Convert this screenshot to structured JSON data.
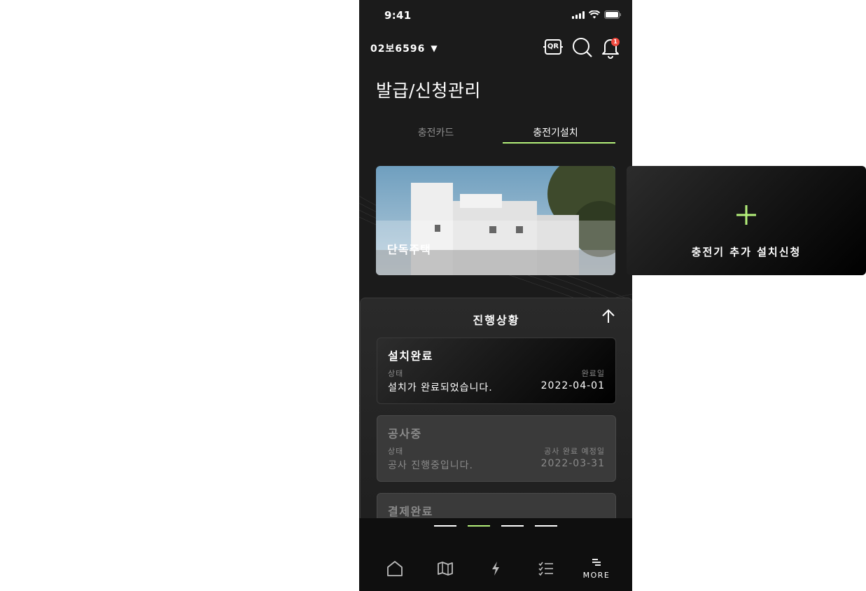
{
  "status": {
    "time": "9:41"
  },
  "header": {
    "vehicle": "02보6596",
    "qr_label": "QR",
    "notification_count": "1"
  },
  "page": {
    "title": "발급/신청관리"
  },
  "tabs": [
    {
      "label": "충전카드",
      "active": false
    },
    {
      "label": "충전기설치",
      "active": true
    }
  ],
  "cards": {
    "house": {
      "label": "단독주택"
    },
    "add": {
      "label": "충전기 추가 설치신청"
    }
  },
  "progress": {
    "title": "진행상황",
    "steps": [
      {
        "title": "설치완료",
        "status_label": "상태",
        "status_value": "설치가 완료되었습니다.",
        "date_label": "완료일",
        "date_value": "2022-04-01"
      },
      {
        "title": "공사중",
        "status_label": "상태",
        "status_value": "공사 진행중입니다.",
        "date_label": "공사 완료 예정일",
        "date_value": "2022-03-31"
      },
      {
        "title": "결제완료"
      }
    ]
  },
  "pager": {
    "count": 4,
    "active_index": 1
  },
  "nav": {
    "more_label": "MORE"
  },
  "colors": {
    "accent": "#b4f07a",
    "badge": "#f0493e",
    "background": "#1b1b1b"
  },
  "icons": [
    "home-icon",
    "map-icon",
    "lightning-icon",
    "checklist-icon",
    "more-icon",
    "qr-icon",
    "search-icon",
    "bell-icon",
    "arrow-up-icon",
    "plus-icon"
  ]
}
